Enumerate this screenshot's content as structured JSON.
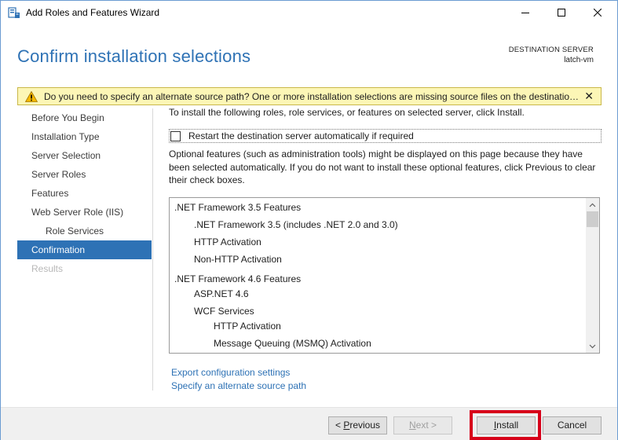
{
  "window": {
    "title": "Add Roles and Features Wizard",
    "min_icon": "minimize-icon",
    "max_icon": "maximize-icon",
    "close_icon": "close-icon"
  },
  "header": {
    "title": "Confirm installation selections",
    "destination_label": "DESTINATION SERVER",
    "destination_name": "latch-vm"
  },
  "warning": {
    "text": "Do you need to specify an alternate source path? One or more installation selections are missing source files on the destination server.",
    "close": "✕",
    "icon": "warning-icon"
  },
  "nav": {
    "items": [
      {
        "label": "Before You Begin",
        "state": "normal"
      },
      {
        "label": "Installation Type",
        "state": "normal"
      },
      {
        "label": "Server Selection",
        "state": "normal"
      },
      {
        "label": "Server Roles",
        "state": "normal"
      },
      {
        "label": "Features",
        "state": "normal"
      },
      {
        "label": "Web Server Role (IIS)",
        "state": "normal"
      },
      {
        "label": "Role Services",
        "state": "sub"
      },
      {
        "label": "Confirmation",
        "state": "active"
      },
      {
        "label": "Results",
        "state": "disabled"
      }
    ]
  },
  "content": {
    "intro": "To install the following roles, role services, or features on selected server, click Install.",
    "restart_label": "Restart the destination server automatically if required",
    "restart_checked": false,
    "optional_note": "Optional features (such as administration tools) might be displayed on this page because they have been selected automatically. If you do not want to install these optional features, click Previous to clear their check boxes.",
    "features": [
      {
        "label": ".NET Framework 3.5 Features",
        "level": 0
      },
      {
        "label": ".NET Framework 3.5 (includes .NET 2.0 and 3.0)",
        "level": 1
      },
      {
        "label": "HTTP Activation",
        "level": 1
      },
      {
        "label": "Non-HTTP Activation",
        "level": 1
      },
      {
        "label": ".NET Framework 4.6 Features",
        "level": 0
      },
      {
        "label": "ASP.NET 4.6",
        "level": 1
      },
      {
        "label": "WCF Services",
        "level": 1
      },
      {
        "label": "HTTP Activation",
        "level": 2
      },
      {
        "label": "Message Queuing (MSMQ) Activation",
        "level": 2
      }
    ],
    "export_link": "Export configuration settings",
    "alt_source_link": "Specify an alternate source path"
  },
  "footer": {
    "previous_prefix": "< ",
    "previous_accel": "P",
    "previous_rest": "revious",
    "next_accel": "N",
    "next_rest": "ext >",
    "install_accel": "I",
    "install_rest": "nstall",
    "cancel": "Cancel"
  },
  "colors": {
    "accent": "#2e72b5",
    "warning_bg": "#fcf6b6",
    "highlight": "#d7001a"
  }
}
